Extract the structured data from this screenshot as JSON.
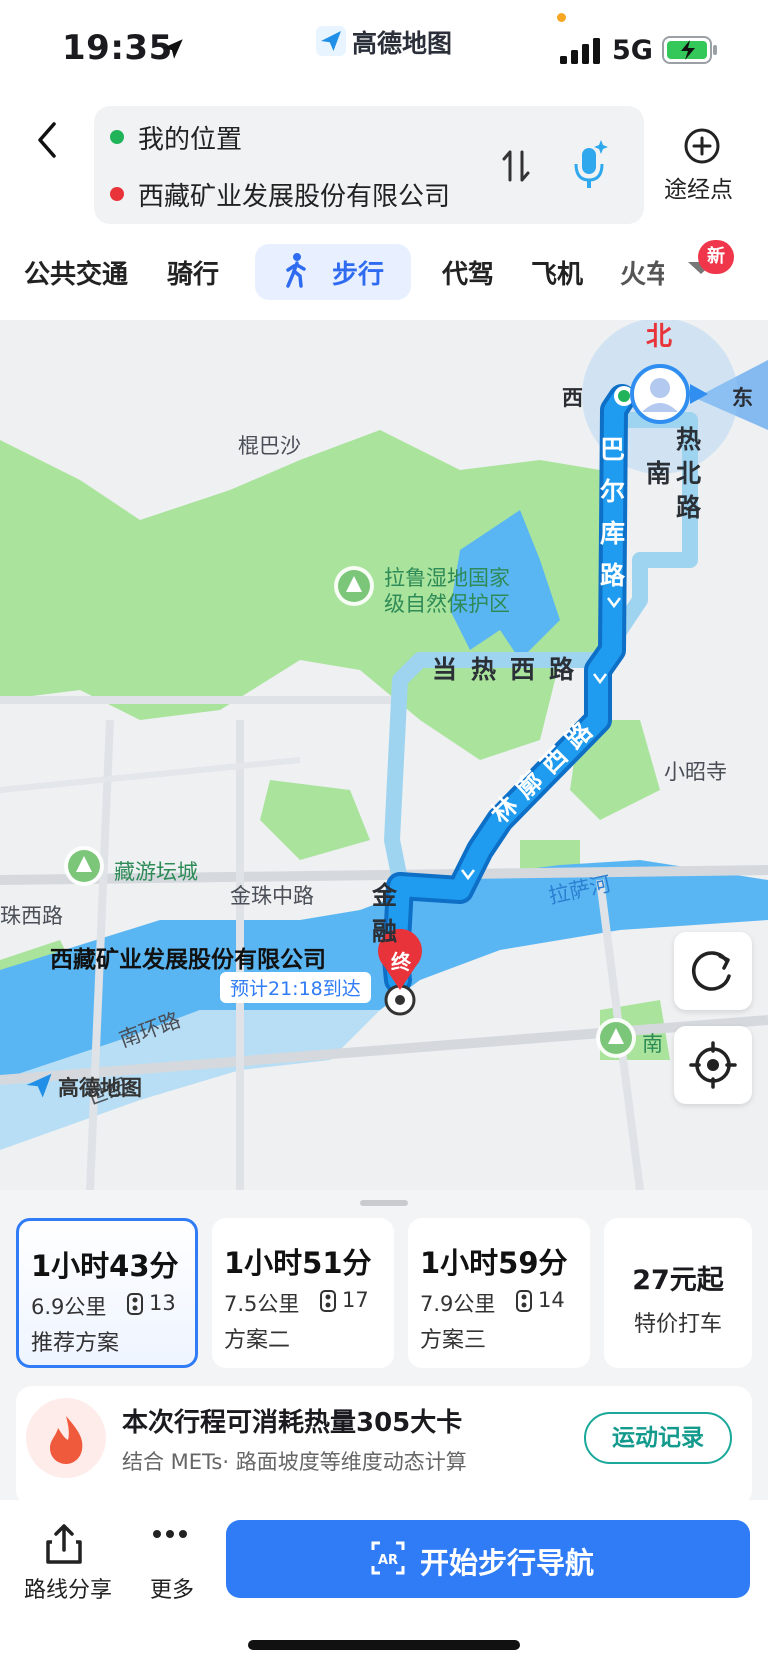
{
  "status_bar": {
    "time": "19:35",
    "app_name": "高德地图",
    "network": "5G"
  },
  "route": {
    "start": "我的位置",
    "end": "西藏矿业发展股份有限公司",
    "waypoint_label": "途经点"
  },
  "modes": {
    "tabs": [
      "公共交通",
      "骑行",
      "步行",
      "代驾",
      "飞机",
      "火车"
    ],
    "active": "步行",
    "new_badge": "新"
  },
  "map": {
    "compass": {
      "north": "北",
      "west": "西",
      "east": "东"
    },
    "labels": {
      "gunbasha": "棍巴沙",
      "lalu_line1": "拉鲁湿地国家",
      "lalu_line2": "级自然保护区",
      "xiaozhaosi": "小昭寺",
      "zangyoutan": "藏游坛城",
      "jinzhu_mid": "金珠中路",
      "zhu_west": "珠西路",
      "lasa_river": "拉萨河",
      "nanhuan": "南环路",
      "shiji": "世纪",
      "nan": "南",
      "jin_rong": [
        "金",
        "融"
      ],
      "barkor_north": [
        "巴",
        "尔",
        "库",
        "路"
      ],
      "rebei": [
        "热",
        "北",
        "路"
      ],
      "rebei_nan": "南",
      "dangre_west": "当热西路",
      "linkuo_west": "林廓西路",
      "destination": "西藏矿业发展股份有限公司",
      "eta": "预计21:18到达",
      "end_marker": "终",
      "watermark": "高德地图"
    }
  },
  "plans": [
    {
      "duration": "1小时43分",
      "distance": "6.9公里",
      "lights": "13",
      "label": "推荐方案",
      "active": true
    },
    {
      "duration": "1小时51分",
      "distance": "7.5公里",
      "lights": "17",
      "label": "方案二",
      "active": false
    },
    {
      "duration": "1小时59分",
      "distance": "7.9公里",
      "lights": "14",
      "label": "方案三",
      "active": false
    }
  ],
  "taxi": {
    "price": "27元起",
    "label": "特价打车"
  },
  "calories": {
    "title": "本次行程可消耗热量305大卡",
    "subtitle": "结合 METs· 路面坡度等维度动态计算",
    "button": "运动记录"
  },
  "actions": {
    "share": "路线分享",
    "more": "更多",
    "start_nav": "开始步行导航"
  },
  "colors": {
    "accent": "#2f7cf6",
    "route": "#1f8fe8",
    "water": "#5ab6f3",
    "park": "#a6e59a"
  }
}
